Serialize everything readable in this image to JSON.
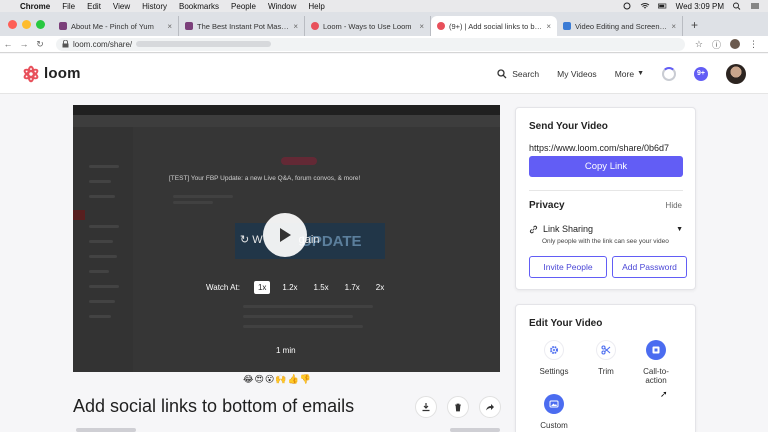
{
  "menubar": {
    "items": [
      "Chrome",
      "File",
      "Edit",
      "View",
      "History",
      "Bookmarks",
      "People",
      "Window",
      "Help"
    ],
    "clock": "Wed 3:09 PM"
  },
  "tabs": [
    {
      "title": "About Me - Pinch of Yum",
      "fav_color": "#7b3f7a"
    },
    {
      "title": "The Best Instant Pot Mashed P",
      "fav_color": "#7b3f7a"
    },
    {
      "title": "Loom - Ways to Use Loom",
      "fav_color": "#e8505b"
    },
    {
      "title": "(9+) | Add social links to botto",
      "fav_color": "#e8505b"
    },
    {
      "title": "Video Editing and Screen Reco",
      "fav_color": "#3a7bd5"
    }
  ],
  "address": {
    "url": "loom.com/share/"
  },
  "header": {
    "brand": "loom",
    "search": "Search",
    "my_videos": "My Videos",
    "more": "More",
    "badge": "9+"
  },
  "video": {
    "embedded_title": "[TEST] Your FBP Update: a new Live Q&A, forum convos, & more!",
    "watch_label": "Watch At:",
    "speeds": [
      "1x",
      "1.2x",
      "1.5x",
      "1.7x",
      "2x"
    ],
    "selected_speed": "1x",
    "duration": "1 min",
    "overlay_text": "W",
    "overlay_text2": "gain",
    "update_text": "UPDATE"
  },
  "reactions": [
    "😂",
    "😍",
    "😮",
    "🙌",
    "👍",
    "👎"
  ],
  "title": "Add social links to bottom of emails",
  "send": {
    "heading": "Send Your Video",
    "url": "https://www.loom.com/share/0b6d7",
    "copy_label": "Copy Link"
  },
  "privacy": {
    "heading": "Privacy",
    "hide": "Hide",
    "setting": "Link Sharing",
    "description": "Only people with the link can see your video",
    "invite_label": "Invite People",
    "password_label": "Add Password"
  },
  "edit": {
    "heading": "Edit Your Video",
    "tools": [
      "Settings",
      "Trim",
      "Call-to-action",
      "Custom"
    ],
    "cta_line1": "Call-to-",
    "cta_line2": "action"
  },
  "colors": {
    "accent": "#625df5",
    "tool_blue": "#4b6cf0"
  }
}
